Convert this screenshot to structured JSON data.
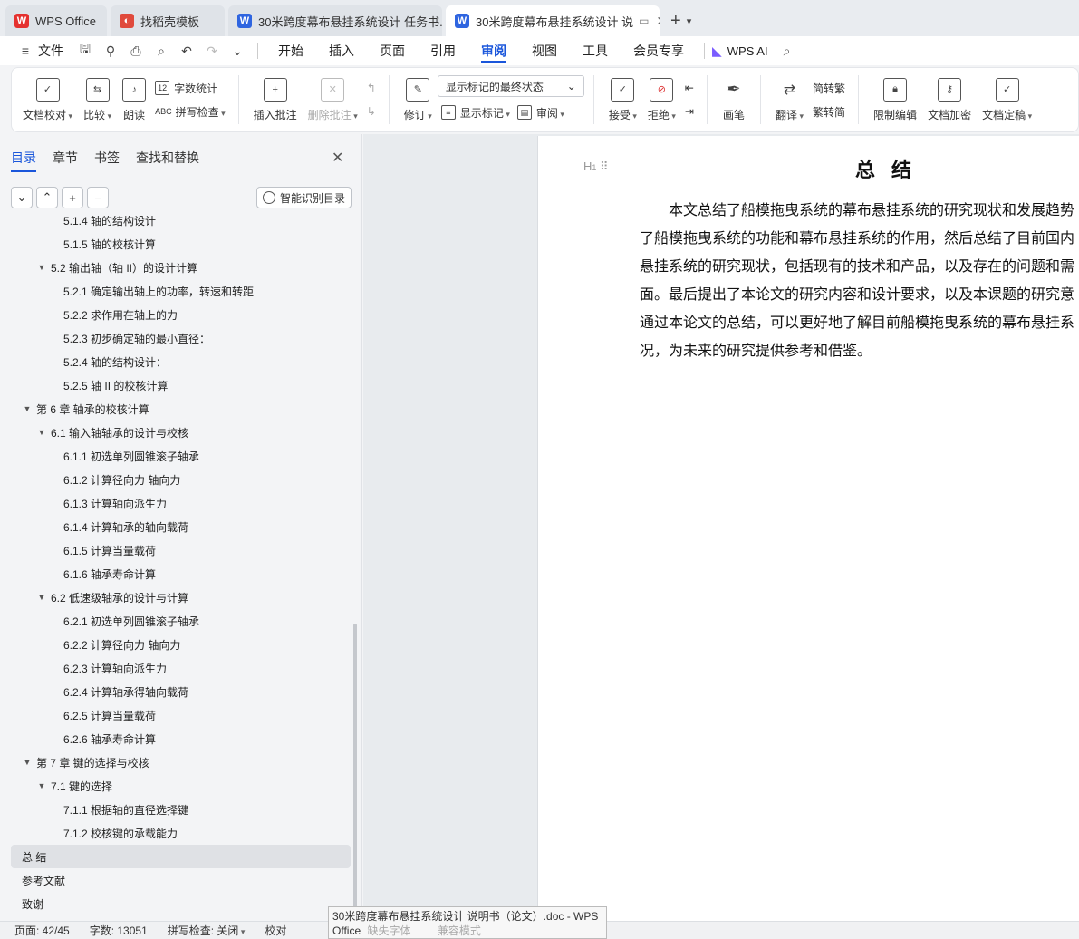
{
  "tabs": [
    {
      "label": "WPS Office",
      "icon": "wps-logo-icon",
      "color": "#e5312f"
    },
    {
      "label": "找稻壳模板",
      "icon": "docer-logo-icon",
      "color": "#e04a3c"
    },
    {
      "label": "30米跨度幕布悬挂系统设计 任务书.dc",
      "icon": "word-doc-icon",
      "color": "#2f65e0"
    },
    {
      "label": "30米跨度幕布悬挂系统设计 说",
      "icon": "word-doc-icon",
      "color": "#2f65e0"
    }
  ],
  "menu": {
    "file": "文件",
    "items": [
      "开始",
      "插入",
      "页面",
      "引用",
      "审阅",
      "视图",
      "工具",
      "会员专享"
    ],
    "active": "审阅",
    "ai": "WPS AI"
  },
  "ribbon": {
    "doc_check": "文档校对",
    "compare": "比较",
    "read_aloud": "朗读",
    "word_count": "字数统计",
    "spell_check": "拼写检查",
    "insert_comment": "插入批注",
    "delete_comment": "删除批注",
    "revise": "修订",
    "markup_state": "显示标记的最终状态",
    "show_markup": "显示标记",
    "review": "审阅",
    "accept": "接受",
    "reject": "拒绝",
    "pen": "画笔",
    "translate": "翻译",
    "to_traditional": "简转繁",
    "to_simplified": "繁转简",
    "restrict_edit": "限制编辑",
    "encrypt": "文档加密",
    "finalize": "文档定稿"
  },
  "nav": {
    "tabs": [
      "目录",
      "章节",
      "书签",
      "查找和替换"
    ],
    "active": "目录",
    "smart_toc": "智能识别目录"
  },
  "toc": [
    {
      "label": "5.1.4   轴的结构设计",
      "level": 3,
      "arrow": false
    },
    {
      "label": "5.1.5   轴的校核计算",
      "level": 3,
      "arrow": false
    },
    {
      "label": "5.2   输出轴（轴 II）的设计计算",
      "level": 2,
      "arrow": true
    },
    {
      "label": "5.2.1   确定输出轴上的功率，转速和转距",
      "level": 3,
      "arrow": false
    },
    {
      "label": "5.2.2   求作用在轴上的力",
      "level": 3,
      "arrow": false
    },
    {
      "label": "5.2.3   初步确定轴的最小直径：",
      "level": 3,
      "arrow": false
    },
    {
      "label": "5.2.4   轴的结构设计：",
      "level": 3,
      "arrow": false
    },
    {
      "label": "5.2.5   轴 II 的校核计算",
      "level": 3,
      "arrow": false
    },
    {
      "label": "第 6 章   轴承的校核计算",
      "level": 1,
      "arrow": true
    },
    {
      "label": "6.1  输入轴轴承的设计与校核",
      "level": 2,
      "arrow": true
    },
    {
      "label": "6.1.1   初选单列圆锥滚子轴承",
      "level": 3,
      "arrow": false
    },
    {
      "label": "6.1.2   计算径向力    轴向力",
      "level": 3,
      "arrow": false
    },
    {
      "label": "6.1.3   计算轴向派生力",
      "level": 3,
      "arrow": false
    },
    {
      "label": "6.1.4   计算轴承的轴向载荷",
      "level": 3,
      "arrow": false
    },
    {
      "label": "6.1.5  计算当量载荷",
      "level": 3,
      "arrow": false
    },
    {
      "label": "6.1.6   轴承寿命计算",
      "level": 3,
      "arrow": false
    },
    {
      "label": "6.2  低速级轴承的设计与计算",
      "level": 2,
      "arrow": true
    },
    {
      "label": "6.2.1   初选单列圆锥滚子轴承",
      "level": 3,
      "arrow": false
    },
    {
      "label": "6.2.2   计算径向力      轴向力",
      "level": 3,
      "arrow": false
    },
    {
      "label": "6.2.3  计算轴向派生力",
      "level": 3,
      "arrow": false
    },
    {
      "label": "6.2.4  计算轴承得轴向载荷",
      "level": 3,
      "arrow": false
    },
    {
      "label": "6.2.5  计算当量载荷",
      "level": 3,
      "arrow": false
    },
    {
      "label": "6.2.6  轴承寿命计算",
      "level": 3,
      "arrow": false
    },
    {
      "label": "第 7 章   键的选择与校核",
      "level": 1,
      "arrow": true
    },
    {
      "label": "7.1  键的选择",
      "level": 2,
      "arrow": true
    },
    {
      "label": "7.1.1  根据轴的直径选择键",
      "level": 3,
      "arrow": false
    },
    {
      "label": "7.1.2  校核键的承载能力",
      "level": 3,
      "arrow": false
    },
    {
      "label": "总   结",
      "level": 1,
      "arrow": false,
      "selected": true
    },
    {
      "label": "参考文献",
      "level": 1,
      "arrow": false
    },
    {
      "label": "致谢",
      "level": 1,
      "arrow": false
    }
  ],
  "document": {
    "heading_marker": "H",
    "title": "总结",
    "lines": [
      "　　本文总结了船模拖曳系统的幕布悬挂系统的研究现状和发展趋势",
      "了船模拖曳系统的功能和幕布悬挂系统的作用，然后总结了目前国内",
      "悬挂系统的研究现状，包括现有的技术和产品，以及存在的问题和需",
      "面。最后提出了本论文的研究内容和设计要求，以及本课题的研究意",
      "通过本论文的总结，可以更好地了解目前船模拖曳系统的幕布悬挂系",
      "况，为未来的研究提供参考和借鉴。"
    ]
  },
  "status": {
    "page": "页面: 42/45",
    "words": "字数: 13051",
    "spell": "拼写检查: 关闭",
    "proof": "校对"
  },
  "tooltip": {
    "line1": "30米跨度幕布悬挂系统设计 说明书（论文）.doc - WPS",
    "line2": "Office",
    "ghost1": "缺失字体",
    "ghost2": "兼容模式"
  }
}
